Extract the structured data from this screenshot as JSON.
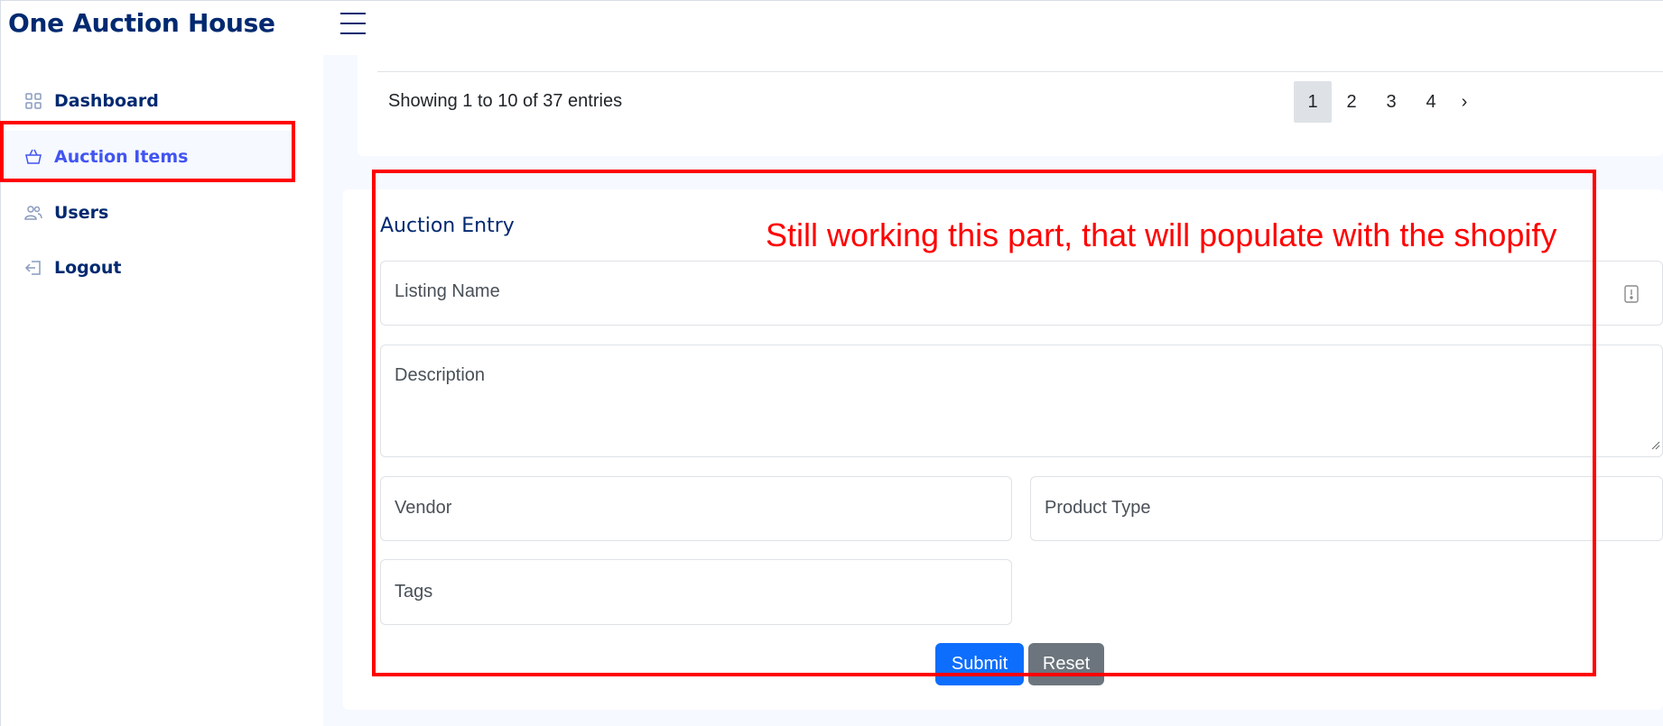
{
  "app": {
    "title": "One Auction House"
  },
  "sidebar": {
    "items": [
      {
        "label": "Dashboard",
        "icon": "grid-icon"
      },
      {
        "label": "Auction Items",
        "icon": "basket-icon"
      },
      {
        "label": "Users",
        "icon": "people-icon"
      },
      {
        "label": "Logout",
        "icon": "logout-icon"
      }
    ],
    "active_index": 1
  },
  "table": {
    "entries_text": "Showing 1 to 10 of 37 entries",
    "pages": [
      "1",
      "2",
      "3",
      "4",
      "›"
    ],
    "active_page": "1"
  },
  "form": {
    "title": "Auction Entry",
    "listing_name": {
      "placeholder": "Listing Name",
      "value": ""
    },
    "description": {
      "placeholder": "Description",
      "value": ""
    },
    "vendor": {
      "placeholder": "Vendor",
      "value": ""
    },
    "product_type": {
      "placeholder": "Product Type",
      "value": ""
    },
    "tags": {
      "placeholder": "Tags",
      "value": ""
    },
    "submit_label": "Submit",
    "reset_label": "Reset"
  },
  "annotation": {
    "text": "Still working this part, that will populate with the shopify"
  },
  "colors": {
    "brand": "#012970",
    "accent": "#4154f1",
    "primary_button": "#0d6efd",
    "secondary_button": "#6c757d",
    "annotation": "#ff0000"
  }
}
